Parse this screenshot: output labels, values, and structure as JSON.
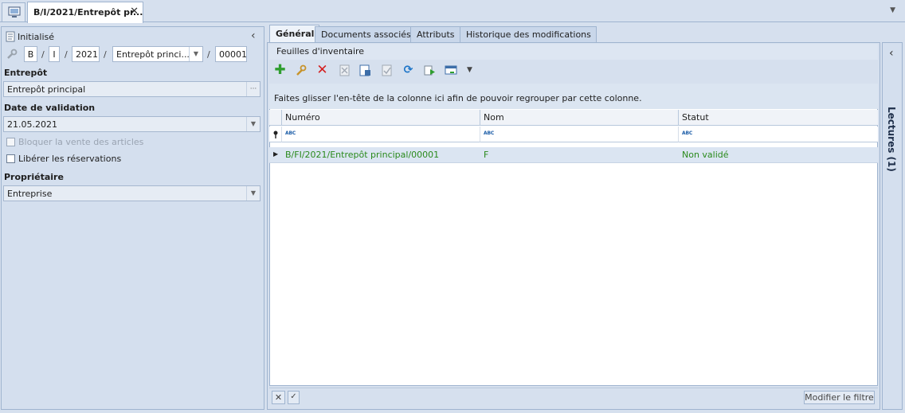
{
  "window_tab": {
    "title": "B/I/2021/Entrepôt pr...",
    "close": "✕"
  },
  "left": {
    "status": "Initialisé",
    "collapse": "‹",
    "number_parts": {
      "series": "B",
      "type": "I",
      "year": "2021",
      "warehouse": "Entrepôt princi...",
      "num": "00001"
    },
    "entrepot": {
      "label": "Entrepôt",
      "value": "Entrepôt principal",
      "button": "···"
    },
    "date": {
      "label": "Date de validation",
      "value": "21.05.2021"
    },
    "bloquer": {
      "label": "Bloquer la vente des articles",
      "checked": false,
      "enabled": false
    },
    "liberer": {
      "label": "Libérer les réservations",
      "checked": false,
      "enabled": true
    },
    "proprietaire": {
      "label": "Propriétaire",
      "value": "Entreprise"
    }
  },
  "tabs": [
    {
      "label": "Général",
      "active": true
    },
    {
      "label": "Documents associés",
      "active": false
    },
    {
      "label": "Attributs",
      "active": false
    },
    {
      "label": "Historique des modifications",
      "active": false
    }
  ],
  "subtab": "Feuilles d'inventaire",
  "toolbar": {
    "add": "add-icon",
    "edit": "wrench-icon",
    "delete": "delete-icon",
    "cancel": "cancel-doc-icon",
    "save": "save-doc-icon",
    "validate": "validate-doc-icon",
    "refresh": "refresh-icon",
    "run": "run-icon",
    "export": "export-icon"
  },
  "grid": {
    "group_hint": "Faites glisser l'en-tête de la colonne ici afin de pouvoir regrouper par cette colonne.",
    "columns": [
      "Numéro",
      "Nom",
      "Statut"
    ],
    "filter_icon": "ABC",
    "rows": [
      {
        "numero": "B/FI/2021/Entrepôt principal/00001",
        "nom": "F",
        "statut": "Non validé"
      }
    ]
  },
  "footer": {
    "filter_button": "Modifier le filtre"
  },
  "side_panel": {
    "label": "Lectures (1)",
    "arrow": "‹"
  },
  "colors": {
    "accent": "#1d5ea8",
    "status_green": "#2a8a1c",
    "add_green": "#2f9e2f",
    "delete_red": "#d42020"
  }
}
